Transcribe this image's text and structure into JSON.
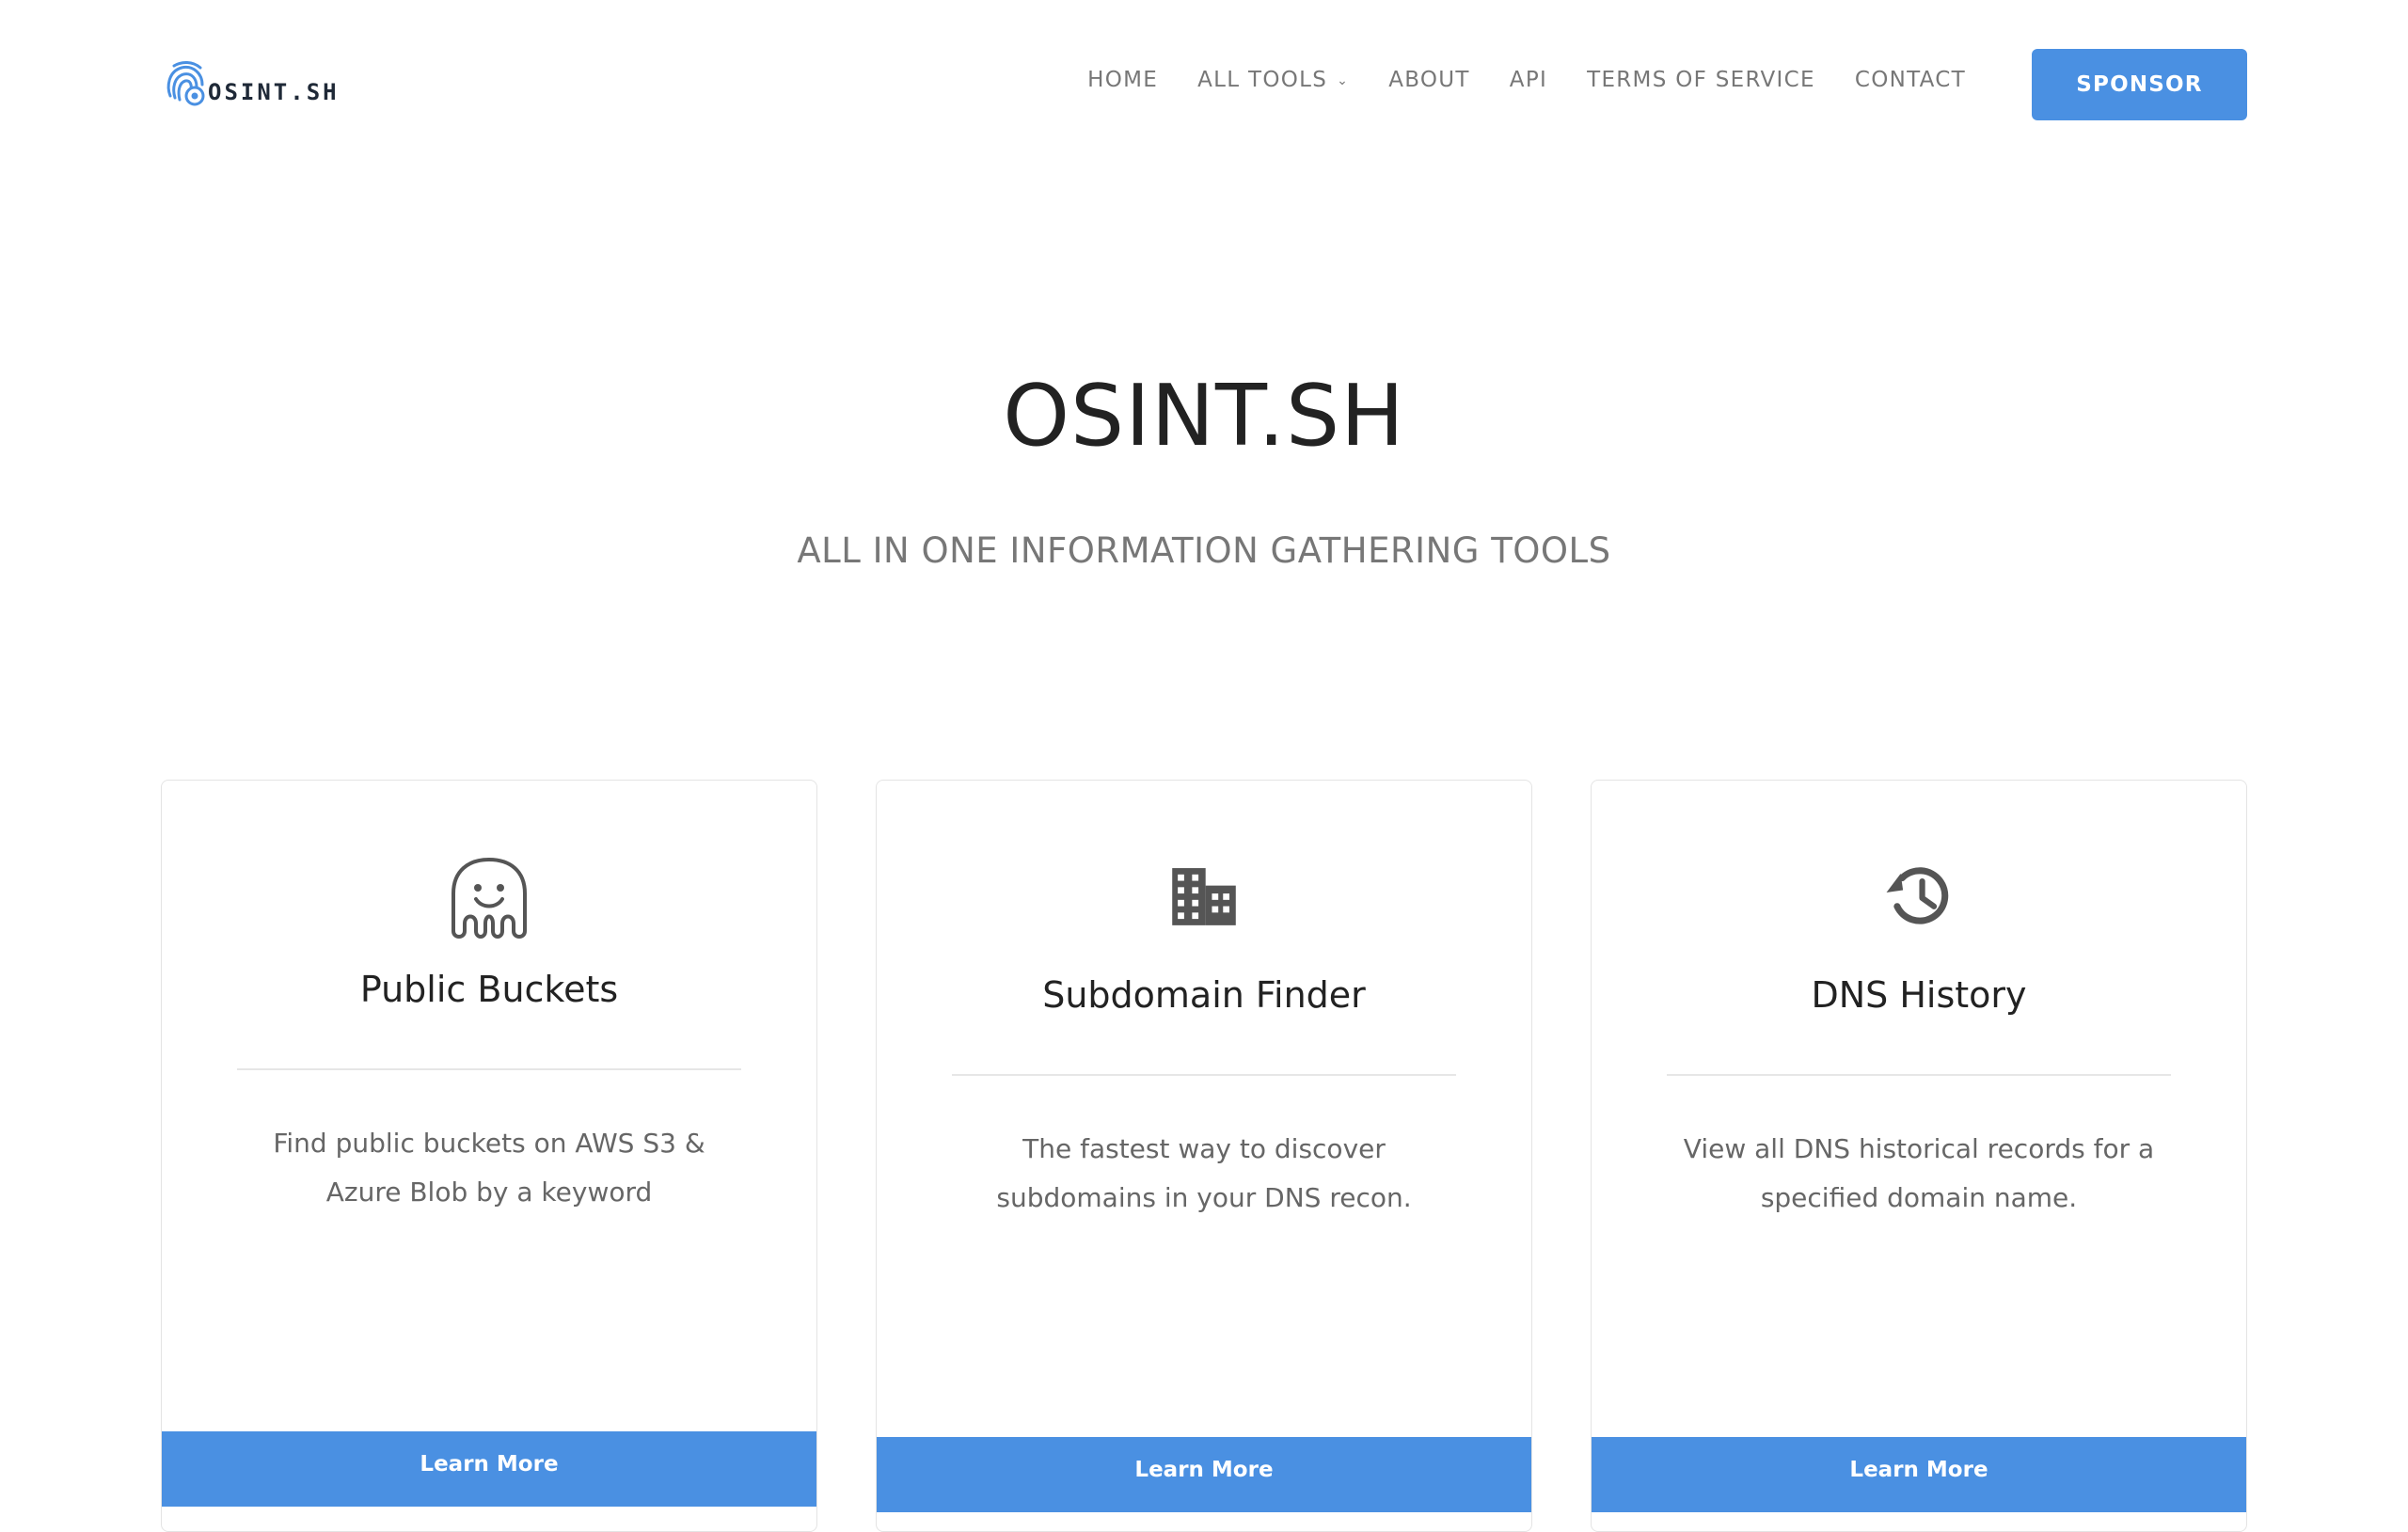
{
  "header": {
    "logo_text": "OSINT.SH",
    "nav": [
      {
        "label": "HOME"
      },
      {
        "label": "ALL TOOLS",
        "dropdown": true
      },
      {
        "label": "ABOUT"
      },
      {
        "label": "API"
      },
      {
        "label": "TERMS OF SERVICE"
      },
      {
        "label": "CONTACT"
      }
    ],
    "sponsor_label": "SPONSOR"
  },
  "hero": {
    "title": "OSINT.SH",
    "subtitle": "ALL IN ONE INFORMATION GATHERING TOOLS"
  },
  "cards": [
    {
      "icon": "ghost-icon",
      "title": "Public Buckets",
      "description": "Find public buckets on AWS S3 & Azure Blob by a keyword",
      "button": "Learn More"
    },
    {
      "icon": "building-icon",
      "title": "Subdomain Finder",
      "description": "The fastest way to discover subdomains in your DNS recon.",
      "button": "Learn More"
    },
    {
      "icon": "history-icon",
      "title": "DNS History",
      "description": "View all DNS historical records for a specified domain name.",
      "button": "Learn More"
    }
  ],
  "colors": {
    "accent": "#4a90e2",
    "text_dark": "#222222",
    "text_muted": "#777777"
  }
}
